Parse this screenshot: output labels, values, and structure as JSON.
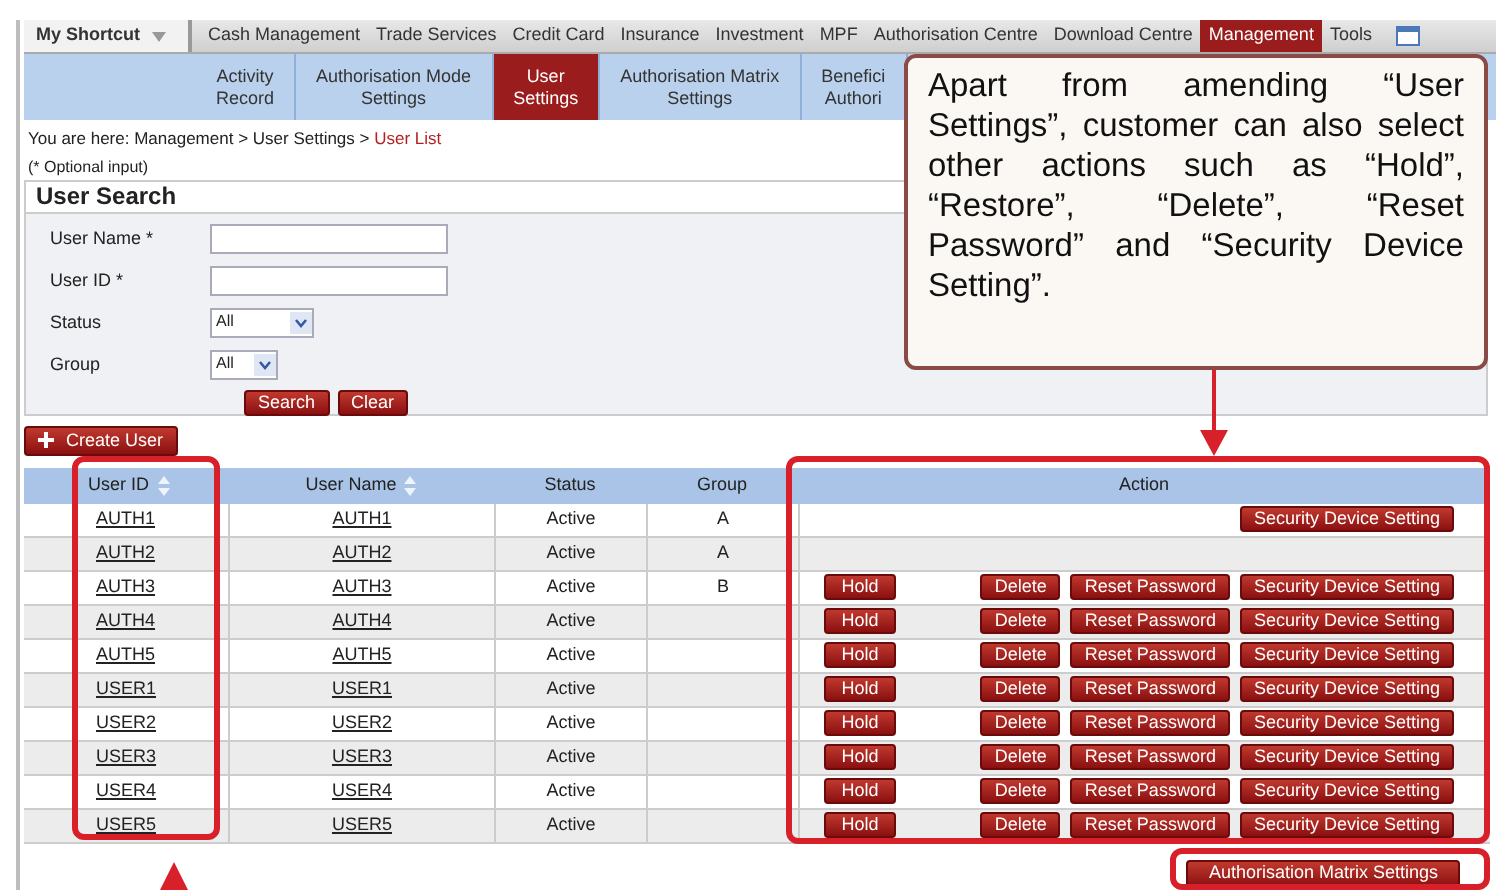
{
  "nav": {
    "shortcut": "My Shortcut",
    "items": [
      {
        "label": "Cash Management",
        "selected": false
      },
      {
        "label": "Trade Services",
        "selected": false
      },
      {
        "label": "Credit Card",
        "selected": false
      },
      {
        "label": "Insurance",
        "selected": false
      },
      {
        "label": "Investment",
        "selected": false
      },
      {
        "label": "MPF",
        "selected": false
      },
      {
        "label": "Authorisation Centre",
        "selected": false
      },
      {
        "label": "Download Centre",
        "selected": false
      },
      {
        "label": "Management",
        "selected": true
      },
      {
        "label": "Tools",
        "selected": false
      }
    ]
  },
  "subnav": [
    {
      "lines": [
        "Activity",
        "Record"
      ],
      "selected": false
    },
    {
      "lines": [
        "Authorisation Mode",
        "Settings"
      ],
      "selected": false
    },
    {
      "lines": [
        "User",
        "Settings"
      ],
      "selected": true
    },
    {
      "lines": [
        "Authorisation Matrix",
        "Settings"
      ],
      "selected": false
    },
    {
      "lines": [
        "Benefici",
        "Authori"
      ],
      "selected": false
    }
  ],
  "breadcrumb": {
    "path": "You are here: Management > User Settings > ",
    "current": "User List"
  },
  "optional_note": "(* Optional input)",
  "search": {
    "title": "User Search",
    "fields": [
      {
        "label": "User Name *",
        "kind": "text"
      },
      {
        "label": "User ID *",
        "kind": "text"
      },
      {
        "label": "Status",
        "kind": "select",
        "value": "All"
      },
      {
        "label": "Group",
        "kind": "select",
        "value": "All"
      }
    ],
    "buttons": [
      "Search",
      "Clear"
    ]
  },
  "create_button": "Create User",
  "table": {
    "columns": [
      {
        "label": "User ID",
        "sortable": true
      },
      {
        "label": "User Name",
        "sortable": true
      },
      {
        "label": "Status",
        "sortable": false
      },
      {
        "label": "Group",
        "sortable": false
      },
      {
        "label": "Action",
        "sortable": false
      }
    ],
    "rows": [
      {
        "user_id": "AUTH1",
        "user_name": "AUTH1",
        "status": "Active",
        "group": "A",
        "left_actions": [],
        "right_actions": [
          "Security Device Setting"
        ]
      },
      {
        "user_id": "AUTH2",
        "user_name": "AUTH2",
        "status": "Active",
        "group": "A",
        "left_actions": [],
        "right_actions": []
      },
      {
        "user_id": "AUTH3",
        "user_name": "AUTH3",
        "status": "Active",
        "group": "B",
        "left_actions": [
          "Hold"
        ],
        "right_actions": [
          "Delete",
          "Reset Password",
          "Security Device Setting"
        ]
      },
      {
        "user_id": "AUTH4",
        "user_name": "AUTH4",
        "status": "Active",
        "left_actions": [
          "Hold"
        ],
        "right_actions": [
          "Delete",
          "Reset Password",
          "Security Device Setting"
        ]
      },
      {
        "user_id": "AUTH5",
        "user_name": "AUTH5",
        "status": "Active",
        "left_actions": [
          "Hold"
        ],
        "right_actions": [
          "Delete",
          "Reset Password",
          "Security Device Setting"
        ]
      },
      {
        "user_id": "USER1",
        "user_name": "USER1",
        "status": "Active",
        "left_actions": [
          "Hold"
        ],
        "right_actions": [
          "Delete",
          "Reset Password",
          "Security Device Setting"
        ]
      },
      {
        "user_id": "USER2",
        "user_name": "USER2",
        "status": "Active",
        "left_actions": [
          "Hold"
        ],
        "right_actions": [
          "Delete",
          "Reset Password",
          "Security Device Setting"
        ]
      },
      {
        "user_id": "USER3",
        "user_name": "USER3",
        "status": "Active",
        "left_actions": [
          "Hold"
        ],
        "right_actions": [
          "Delete",
          "Reset Password",
          "Security Device Setting"
        ]
      },
      {
        "user_id": "USER4",
        "user_name": "USER4",
        "status": "Active",
        "left_actions": [
          "Hold"
        ],
        "right_actions": [
          "Delete",
          "Reset Password",
          "Security Device Setting"
        ]
      },
      {
        "user_id": "USER5",
        "user_name": "USER5",
        "status": "Active",
        "left_actions": [
          "Hold"
        ],
        "right_actions": [
          "Delete",
          "Reset Password",
          "Security Device Setting"
        ]
      }
    ]
  },
  "footer_button": "Authorisation Matrix Settings",
  "callout": "Apart from amending “User Settings”, customer can also select other actions such as “Hold”, “Restore”, “Delete”, “Reset Password” and “Security Device Setting”."
}
